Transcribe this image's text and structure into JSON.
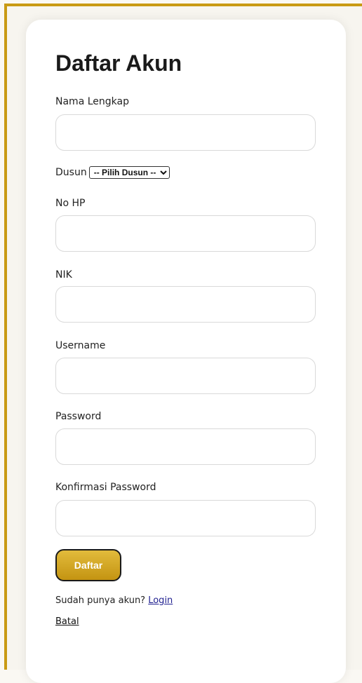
{
  "form": {
    "title": "Daftar Akun",
    "fields": {
      "nama": {
        "label": "Nama Lengkap",
        "value": "",
        "placeholder": ""
      },
      "dusun": {
        "label": "Dusun",
        "selected": "-- Pilih Dusun --"
      },
      "nohp": {
        "label": "No HP",
        "value": "",
        "placeholder": ""
      },
      "nik": {
        "label": "NIK",
        "value": "",
        "placeholder": ""
      },
      "username": {
        "label": "Username",
        "value": "",
        "placeholder": ""
      },
      "password": {
        "label": "Password",
        "value": "",
        "placeholder": ""
      },
      "konfirmasi": {
        "label": "Konfirmasi Password",
        "value": "",
        "placeholder": ""
      }
    },
    "submit_label": "Daftar",
    "login_prompt": "Sudah punya akun?",
    "login_link": "Login",
    "cancel_link": "Batal"
  },
  "colors": {
    "frame_border": "#c99a14",
    "button_gold": "#d4a825",
    "link": "#1f1f8f"
  }
}
